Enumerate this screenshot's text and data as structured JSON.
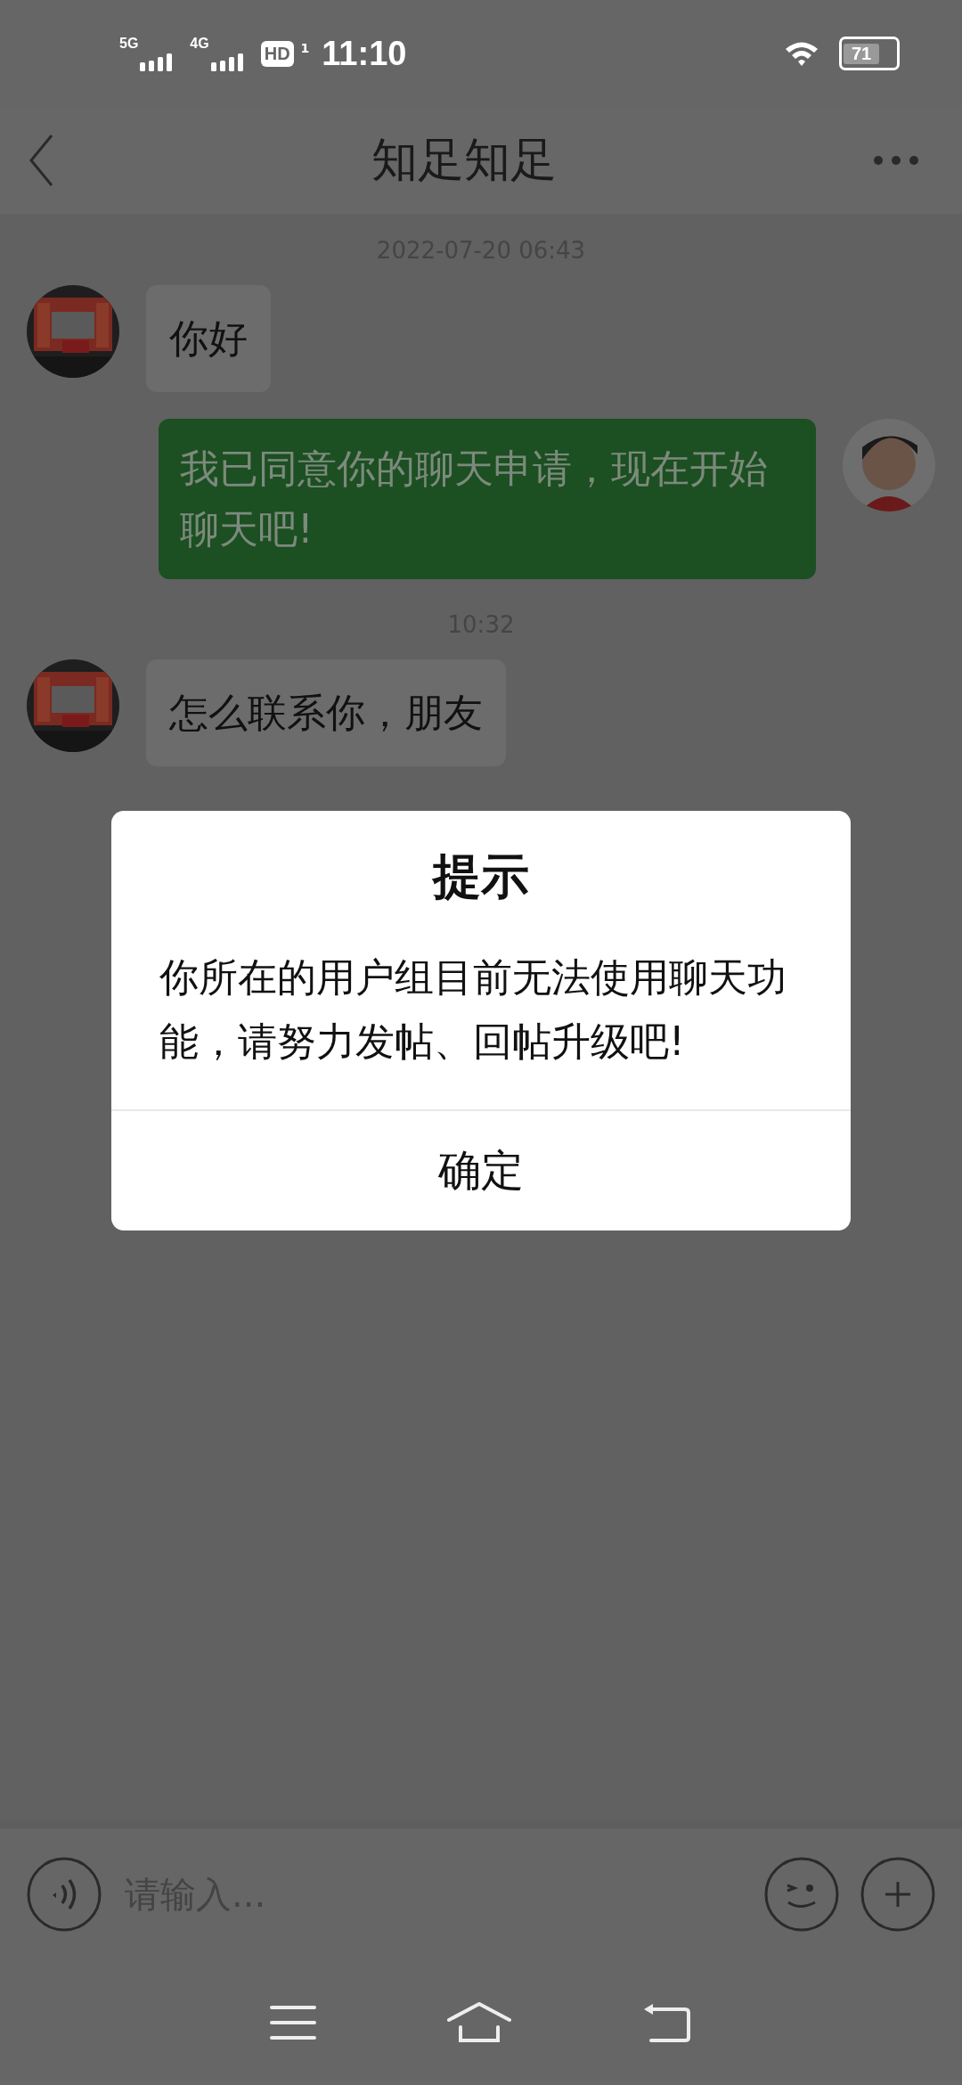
{
  "status_bar": {
    "network_1": "5G",
    "network_2": "4G",
    "hd_badge": "HD",
    "sim_slot": "1",
    "time": "11:10",
    "battery": "71"
  },
  "header": {
    "title": "知足知足"
  },
  "messages": [
    {
      "kind": "time",
      "text": "2022-07-20 06:43"
    },
    {
      "kind": "incoming",
      "text": "你好"
    },
    {
      "kind": "outgoing",
      "text": "我已同意你的聊天申请，现在开始聊天吧!"
    },
    {
      "kind": "time",
      "text": "10:32"
    },
    {
      "kind": "incoming",
      "text": "怎么联系你，朋友"
    }
  ],
  "dialog": {
    "title": "提示",
    "message": "你所在的用户组目前无法使用聊天功能，请努力发帖、回帖升级吧!",
    "button": "确定"
  },
  "input_bar": {
    "placeholder": "请输入..."
  }
}
